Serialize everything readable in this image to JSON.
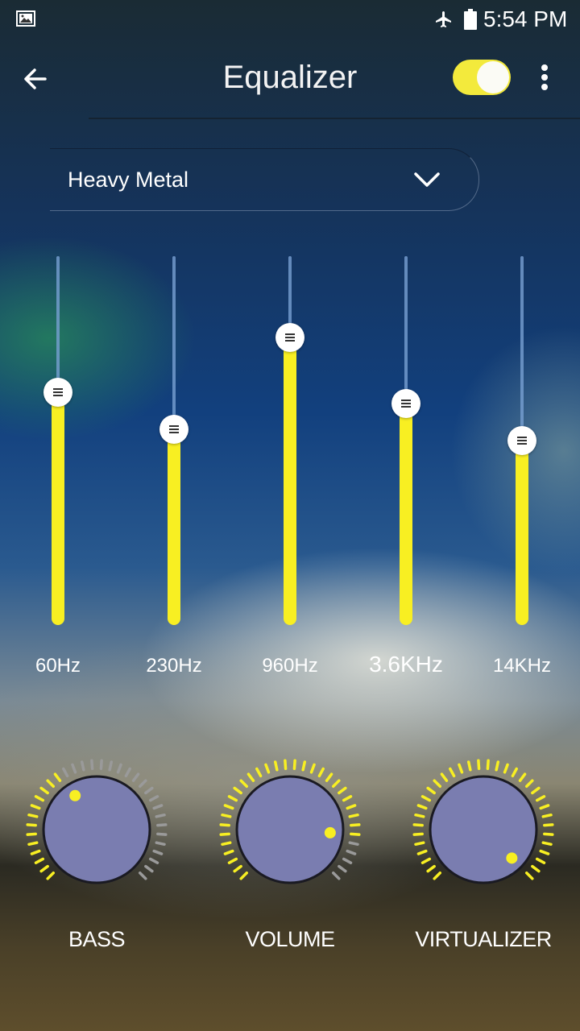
{
  "status_bar": {
    "time": "5:54 PM",
    "icons": [
      "image-icon",
      "airplane-mode-icon",
      "battery-icon"
    ]
  },
  "app_bar": {
    "title": "Equalizer",
    "back_icon": "arrow-left-icon",
    "toggle_on": true,
    "menu_icon": "more-vertical-icon"
  },
  "preset": {
    "value": "Heavy Metal",
    "icon": "chevron-down-icon"
  },
  "bands": [
    {
      "label": "60Hz",
      "level": 0.63
    },
    {
      "label": "230Hz",
      "level": 0.53
    },
    {
      "label": "960Hz",
      "level": 0.78
    },
    {
      "label": "3.6KHz",
      "level": 0.6
    },
    {
      "label": "14KHz",
      "level": 0.5
    }
  ],
  "knobs": [
    {
      "label": "BASS",
      "level": 0.38
    },
    {
      "label": "VOLUME",
      "level": 0.85
    },
    {
      "label": "VIRTUALIZER",
      "level": 1.0
    }
  ],
  "colors": {
    "accent": "#f8ef22",
    "knob_face": "#7a7db0",
    "tick_off": "#9a9a9a"
  }
}
